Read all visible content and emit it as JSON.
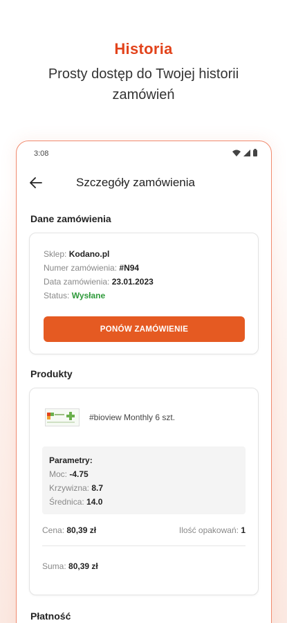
{
  "promo": {
    "title": "Historia",
    "subtitle": "Prosty dostęp do Twojej historii zamówień"
  },
  "status_bar": {
    "time": "3:08",
    "icons": [
      "wifi-icon",
      "signal-icon",
      "battery-icon"
    ]
  },
  "appbar": {
    "title": "Szczegóły zamówienia"
  },
  "order": {
    "section_title": "Dane zamówienia",
    "shop_label": "Sklep:",
    "shop_value": "Kodano.pl",
    "number_label": "Numer zamówienia:",
    "number_value": "#N94",
    "date_label": "Data zamówienia:",
    "date_value": "23.01.2023",
    "status_label": "Status:",
    "status_value": "Wysłane",
    "status_color": "#2e9a3a",
    "reorder_label": "PONÓW ZAMÓWIENIE"
  },
  "products": {
    "section_title": "Produkty",
    "items": [
      {
        "name": "#bioview Monthly 6 szt.",
        "params_title": "Parametry:",
        "power_label": "Moc:",
        "power_value": "-4.75",
        "curvature_label": "Krzywizna:",
        "curvature_value": "8.7",
        "diameter_label": "Średnica:",
        "diameter_value": "14.0",
        "price_label": "Cena:",
        "price_value": "80,39 zł",
        "qty_label": "Ilość opakowań:",
        "qty_value": "1",
        "sum_label": "Suma:",
        "sum_value": "80,39 zł"
      }
    ]
  },
  "payment": {
    "section_title": "Płatność"
  },
  "colors": {
    "accent": "#e55a22",
    "title_red": "#e2431b"
  }
}
